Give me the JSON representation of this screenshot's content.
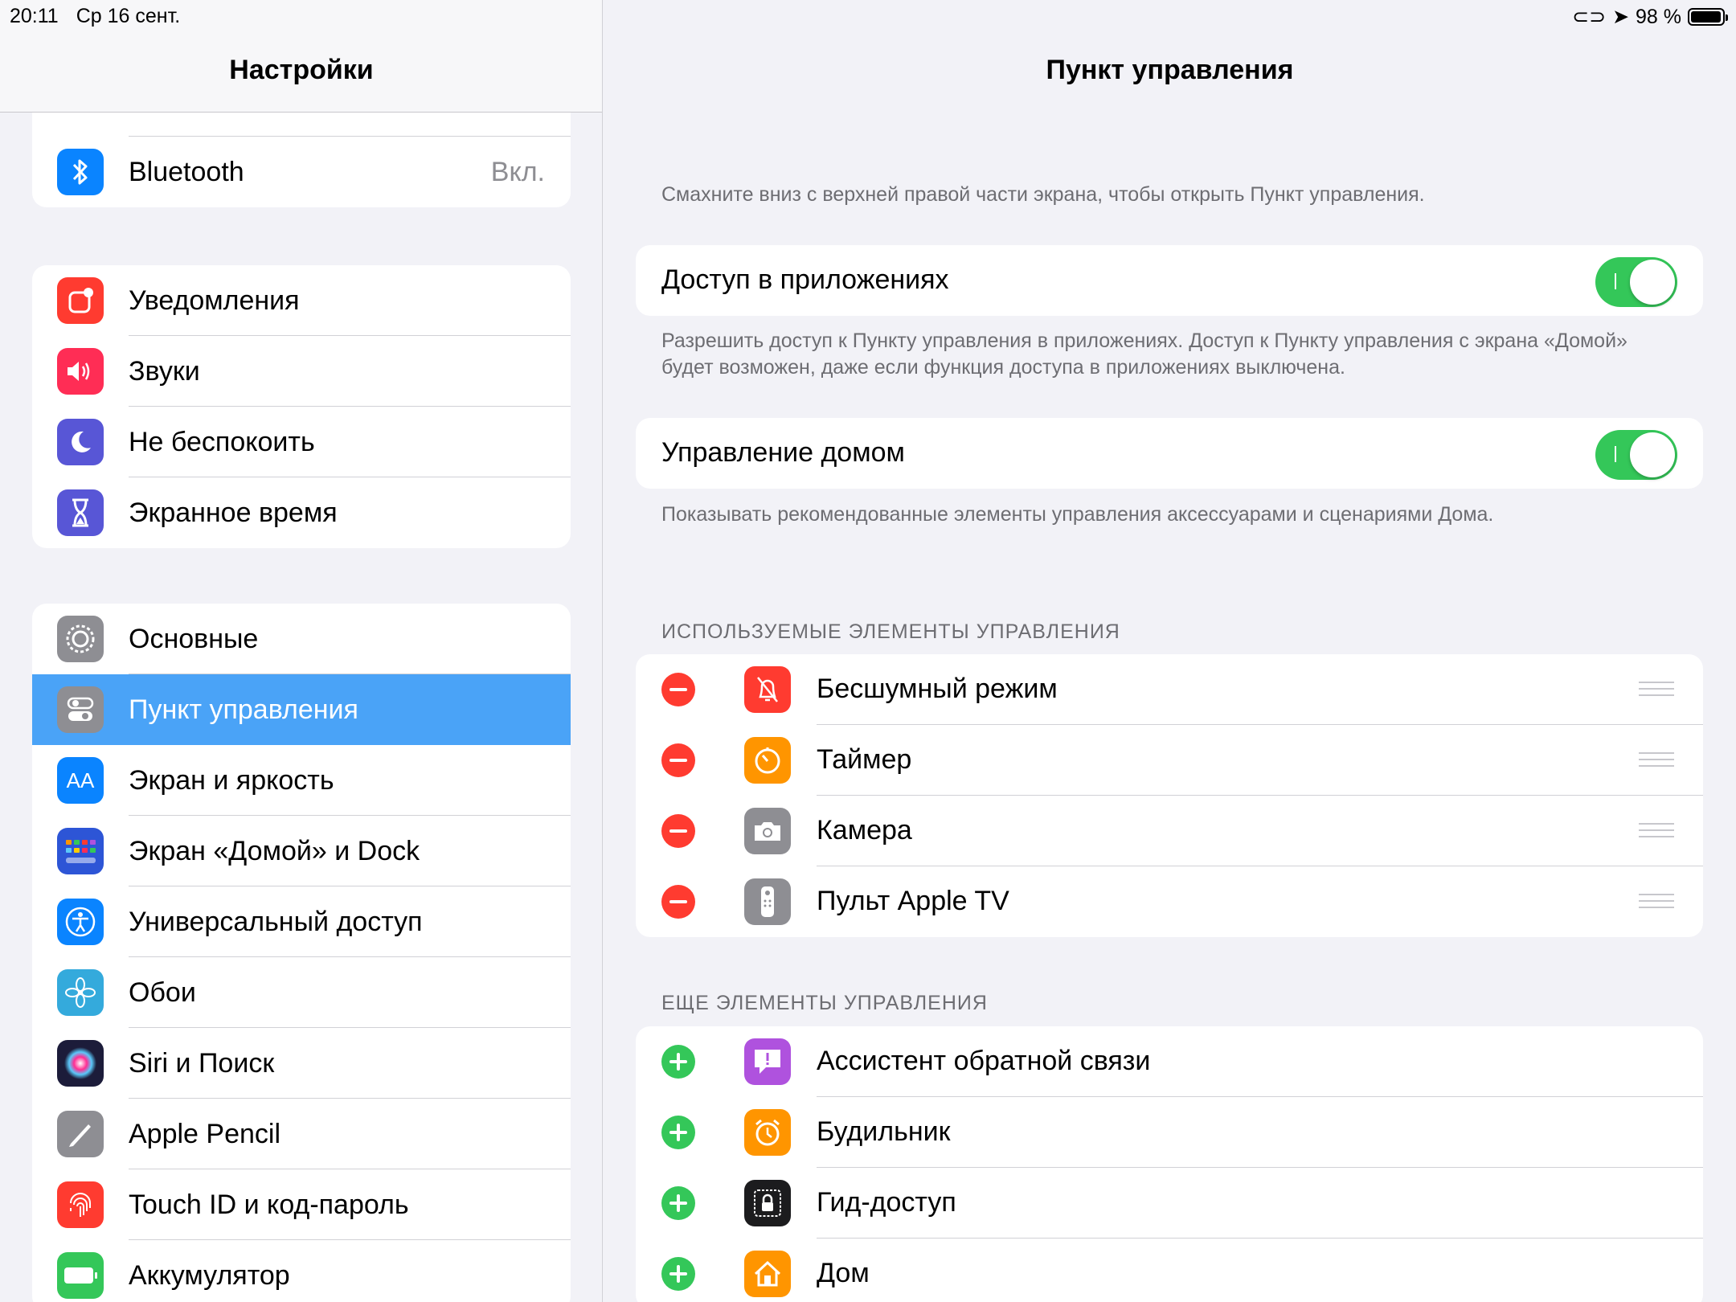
{
  "status": {
    "time": "20:11",
    "date": "Ср 16 сент.",
    "battery": "98 %"
  },
  "sidebar": {
    "title": "Настройки",
    "group1": [
      {
        "label": "Bluetooth",
        "value": "Вкл.",
        "icon": "bluetooth-icon",
        "color": "#0a84ff"
      }
    ],
    "group2": [
      {
        "label": "Уведомления",
        "icon": "notifications-icon",
        "color": "#ff3b30"
      },
      {
        "label": "Звуки",
        "icon": "sounds-icon",
        "color": "#ff2d55"
      },
      {
        "label": "Не беспокоить",
        "icon": "moon-icon",
        "color": "#5856d6"
      },
      {
        "label": "Экранное время",
        "icon": "hourglass-icon",
        "color": "#5856d6"
      }
    ],
    "group3": [
      {
        "label": "Основные",
        "icon": "gear-icon",
        "color": "#8e8e93"
      },
      {
        "label": "Пункт управления",
        "icon": "toggles-icon",
        "color": "#8e8e93",
        "selected": true
      },
      {
        "label": "Экран и яркость",
        "icon": "display-aa-icon",
        "color": "#0a84ff"
      },
      {
        "label": "Экран «Домой» и Dock",
        "icon": "home-grid-icon",
        "color": "#2d55d6"
      },
      {
        "label": "Универсальный доступ",
        "icon": "accessibility-icon",
        "color": "#0a84ff"
      },
      {
        "label": "Обои",
        "icon": "flower-icon",
        "color": "#34aadc"
      },
      {
        "label": "Siri и Поиск",
        "icon": "siri-icon",
        "color": "#1c1c3a"
      },
      {
        "label": "Apple Pencil",
        "icon": "pencil-icon",
        "color": "#8e8e93"
      },
      {
        "label": "Touch ID и код-пароль",
        "icon": "fingerprint-icon",
        "color": "#ff3b30"
      },
      {
        "label": "Аккумулятор",
        "icon": "battery-icon",
        "color": "#34c759"
      }
    ]
  },
  "main": {
    "title": "Пункт управления",
    "intro": "Смахните вниз с верхней правой части экрана, чтобы открыть Пункт управления.",
    "access_in_apps": {
      "label": "Доступ в приложениях",
      "on": true
    },
    "access_note": "Разрешить доступ к Пункту управления в приложениях. Доступ к Пункту управления с экрана «Домой» будет возможен, даже если функция доступа в приложениях выключена.",
    "home_control": {
      "label": "Управление домом",
      "on": true
    },
    "home_note": "Показывать рекомендованные элементы управления аксессуарами и сценариями Дома.",
    "included_header": "ИСПОЛЬЗУЕМЫЕ ЭЛЕМЕНТЫ УПРАВЛЕНИЯ",
    "included": [
      {
        "label": "Бесшумный режим",
        "icon": "bell-slash-icon",
        "color": "#ff3b30"
      },
      {
        "label": "Таймер",
        "icon": "timer-icon",
        "color": "#ff9500"
      },
      {
        "label": "Камера",
        "icon": "camera-icon",
        "color": "#8e8e93"
      },
      {
        "label": "Пульт Apple TV",
        "icon": "remote-icon",
        "color": "#8e8e93"
      }
    ],
    "more_header": "ЕЩЕ ЭЛЕМЕНТЫ УПРАВЛЕНИЯ",
    "more": [
      {
        "label": "Ассистент обратной связи",
        "icon": "feedback-icon",
        "color": "#af52de"
      },
      {
        "label": "Будильник",
        "icon": "alarm-icon",
        "color": "#ff9500"
      },
      {
        "label": "Гид-доступ",
        "icon": "guided-access-icon",
        "color": "#1c1c1e"
      },
      {
        "label": "Дом",
        "icon": "home-icon",
        "color": "#ff9500"
      }
    ]
  }
}
